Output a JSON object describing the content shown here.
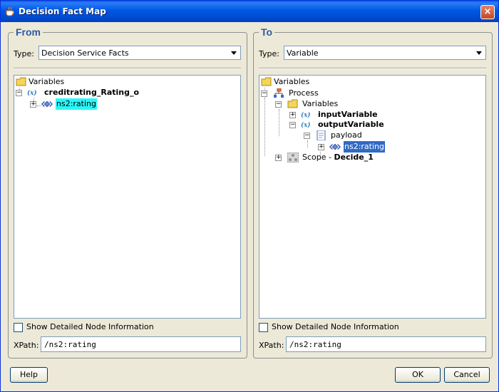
{
  "window": {
    "title": "Decision Fact Map",
    "close_glyph": "×"
  },
  "from_panel": {
    "legend": "From",
    "type_label": "Type:",
    "type_value": "Decision Service Facts",
    "tree": {
      "root_label": "Variables",
      "variable_label": "creditrating_Rating_o",
      "element_label": "ns2:rating"
    },
    "show_detail_label": "Show Detailed Node Information",
    "xpath_label": "XPath:",
    "xpath_value": "/ns2:rating"
  },
  "to_panel": {
    "legend": "To",
    "type_label": "Type:",
    "type_value": "Variable",
    "tree": {
      "root_label": "Variables",
      "process_label": "Process",
      "process_vars_label": "Variables",
      "input_var_label": "inputVariable",
      "output_var_label": "outputVariable",
      "payload_label": "payload",
      "element_label": "ns2:rating",
      "scope_prefix": "Scope - ",
      "scope_name": "Decide_1"
    },
    "show_detail_label": "Show Detailed Node Information",
    "xpath_label": "XPath:",
    "xpath_value": "/ns2:rating"
  },
  "buttons": {
    "help": "Help",
    "ok": "OK",
    "cancel": "Cancel"
  },
  "icons": {
    "window": "coffee-cup-icon",
    "folder": "folder-icon",
    "variable": "variable-x-icon",
    "element": "xml-element-icon",
    "process": "process-icon",
    "payload": "document-icon",
    "scope": "scope-icon",
    "dropdown": "chevron-down-icon"
  },
  "colors": {
    "title_bar": "#0058e6",
    "legend": "#2c5ba8",
    "highlight_cyan": "#2bf6f6",
    "highlight_selected": "#316ac5"
  }
}
